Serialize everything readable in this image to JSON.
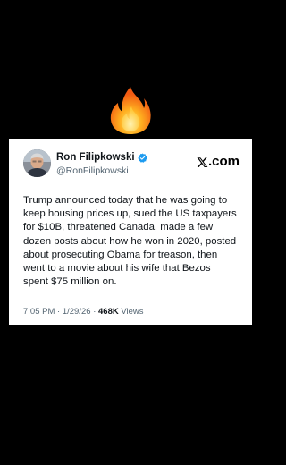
{
  "post": {
    "author_name": "Ron Filipkowski",
    "author_handle": "@RonFilipkowski",
    "source_label": ".com",
    "text": "Trump announced today that he was going to keep housing prices up, sued the US taxpayers for $10B, threatened Canada, made a few dozen posts about how he won in 2020, posted about prosecuting Obama for treason, then went to a movie about his wife that Bezos spent $75 million on.",
    "time": "7:05 PM",
    "date": "1/29/26",
    "separator": "·",
    "views_count": "468K",
    "views_label": "Views"
  },
  "icons": {
    "fire": "fire-emoji-icon",
    "verified": "verified-badge-icon",
    "x_logo": "x-logo-icon"
  },
  "colors": {
    "background": "#000000",
    "card": "#ffffff",
    "verified_blue": "#1d9bf0",
    "secondary_text": "#536471"
  }
}
